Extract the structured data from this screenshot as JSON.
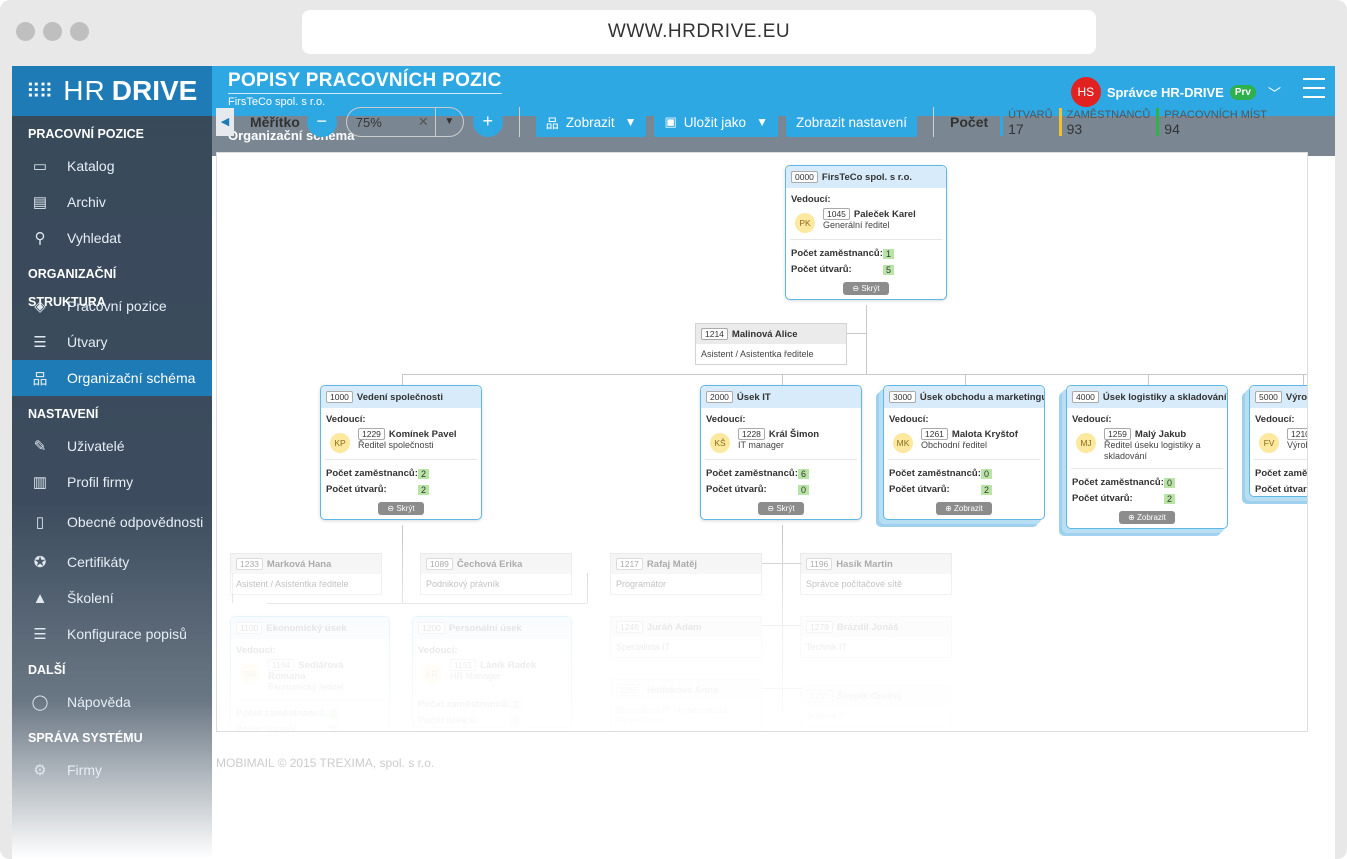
{
  "browser": {
    "url": "WWW.HRDRIVE.EU"
  },
  "logo": {
    "part1": "HR",
    "part2": "DRIVE"
  },
  "header": {
    "title": "POPISY PRACOVNÍCH POZIC",
    "subtitle": "FirsTeCo spol. s r.o.",
    "user_initials": "HS",
    "user_name": "Správce HR-DRIVE",
    "user_badge": "Prv"
  },
  "subheader": {
    "title": "Organizační schéma"
  },
  "sidebar": {
    "sections": [
      {
        "title": "PRACOVNÍ POZICE",
        "items": [
          {
            "label": "Katalog",
            "icon": "inbox-icon"
          },
          {
            "label": "Archiv",
            "icon": "archive-icon"
          },
          {
            "label": "Vyhledat",
            "icon": "search-icon"
          }
        ]
      },
      {
        "title": "ORGANIZAČNÍ STRUKTURA",
        "items": [
          {
            "label": "Pracovní pozice",
            "icon": "position-icon"
          },
          {
            "label": "Útvary",
            "icon": "units-icon"
          },
          {
            "label": "Organizační schéma",
            "icon": "org-chart-icon",
            "active": true
          }
        ]
      },
      {
        "title": "NASTAVENÍ",
        "items": [
          {
            "label": "Uživatelé",
            "icon": "users-icon"
          },
          {
            "label": "Profil firmy",
            "icon": "company-icon"
          },
          {
            "label": "Obecné odpovědnosti",
            "icon": "document-icon"
          },
          {
            "label": "Certifikáty",
            "icon": "certificate-icon"
          },
          {
            "label": "Školení",
            "icon": "training-icon"
          },
          {
            "label": "Konfigurace popisů",
            "icon": "config-icon"
          }
        ]
      },
      {
        "title": "DALŠÍ",
        "items": [
          {
            "label": "Nápověda",
            "icon": "help-icon"
          }
        ]
      },
      {
        "title": "SPRÁVA SYSTÉMU",
        "items": [
          {
            "label": "Firmy",
            "icon": "gear-icon"
          }
        ]
      }
    ]
  },
  "toolbar": {
    "scale_label": "Měřítko",
    "zoom_value": "75%",
    "show_label": "Zobrazit",
    "save_label": "Uložit jako",
    "settings_label": "Zobrazit nastavení",
    "count_label": "Počet"
  },
  "stats": [
    {
      "label": "ÚTVARŮ",
      "value": "17",
      "color": "#2ea8e3"
    },
    {
      "label": "ZAMĚSTNANCŮ",
      "value": "93",
      "color": "#f2c12e"
    },
    {
      "label": "PRACOVNÍCH MÍST",
      "value": "94",
      "color": "#2eb14a"
    }
  ],
  "labels": {
    "manager": "Vedoucí:",
    "employees": "Počet zaměstnanců:",
    "units": "Počet útvarů:",
    "hide": "Skrýt",
    "show": "Zobrazit"
  },
  "root": {
    "code": "0000",
    "name": "FirsTeCo spol. s r.o.",
    "mgr_initials": "PK",
    "mgr_code": "1045",
    "mgr_name": "Paleček Karel",
    "mgr_pos": "Generální ředitel",
    "employees": "1",
    "units": "5"
  },
  "root_assistant": {
    "code": "1214",
    "name": "Malinová Alice",
    "pos": "Asistent / Asistentka ředitele"
  },
  "departments": [
    {
      "code": "1000",
      "name": "Vedení společnosti",
      "mgr_initials": "KP",
      "mgr_code": "1229",
      "mgr_name": "Komínek Pavel",
      "mgr_pos": "Ředitel společnosti",
      "employees": "2",
      "units": "2",
      "toggle": "Skrýt"
    },
    {
      "code": "2000",
      "name": "Úsek IT",
      "mgr_initials": "KŠ",
      "mgr_code": "1228",
      "mgr_name": "Král Šimon",
      "mgr_pos": "IT manager",
      "employees": "6",
      "units": "0",
      "toggle": "Skrýt"
    },
    {
      "code": "3000",
      "name": "Úsek obchodu a marketingu",
      "mgr_initials": "MK",
      "mgr_code": "1261",
      "mgr_name": "Malota Kryštof",
      "mgr_pos": "Obchodní ředitel",
      "employees": "0",
      "units": "2",
      "toggle": "Zobrazit"
    },
    {
      "code": "4000",
      "name": "Úsek logistiky a skladování",
      "mgr_initials": "MJ",
      "mgr_code": "1259",
      "mgr_name": "Malý Jakub",
      "mgr_pos": "Ředitel úseku logistiky a skladování",
      "employees": "0",
      "units": "2",
      "toggle": "Zobrazit"
    },
    {
      "code": "5000",
      "name": "Výrob",
      "mgr_initials": "FV",
      "mgr_code": "1210",
      "mgr_name": "",
      "mgr_pos": "Výrobn",
      "employees": "",
      "units": "",
      "toggle": ""
    }
  ],
  "sub_positions": [
    {
      "code": "1233",
      "name": "Marková Hana",
      "pos": "Asistent / Asistentka ředitele"
    },
    {
      "code": "1089",
      "name": "Čechová Erika",
      "pos": "Podnikový právník"
    },
    {
      "code": "1217",
      "name": "Rafaj Matěj",
      "pos": "Programátor"
    },
    {
      "code": "1196",
      "name": "Hasík Martin",
      "pos": "Správce počítačové sítě"
    },
    {
      "code": "1246",
      "name": "Juráň Adam",
      "pos": "Specialista IT"
    },
    {
      "code": "1279",
      "name": "Brázdil Jonáš",
      "pos": "Technik IT"
    },
    {
      "code": "1265",
      "name": "Holínková Anna",
      "pos": "Specialista IT - kybernetická bezpečnost"
    },
    {
      "code": "1251",
      "name": "Škopík Ondřej",
      "pos": "Technik IT"
    }
  ],
  "sub_units": [
    {
      "code": "1100",
      "name": "Ekonomický úsek",
      "mgr_initials": "SR",
      "mgr_code": "1194",
      "mgr_name": "Sedlářová Romana",
      "mgr_pos": "Ekonomický ředitel",
      "employees": "5",
      "units": "0"
    },
    {
      "code": "1200",
      "name": "Personální úsek",
      "mgr_initials": "LR",
      "mgr_code": "1151",
      "mgr_name": "Láník Radek",
      "mgr_pos": "HR Manager",
      "employees": "3",
      "units": "0"
    }
  ],
  "footer": {
    "text": "MOBIMAIL © 2015 TREXIMA, spol. s r.o."
  }
}
